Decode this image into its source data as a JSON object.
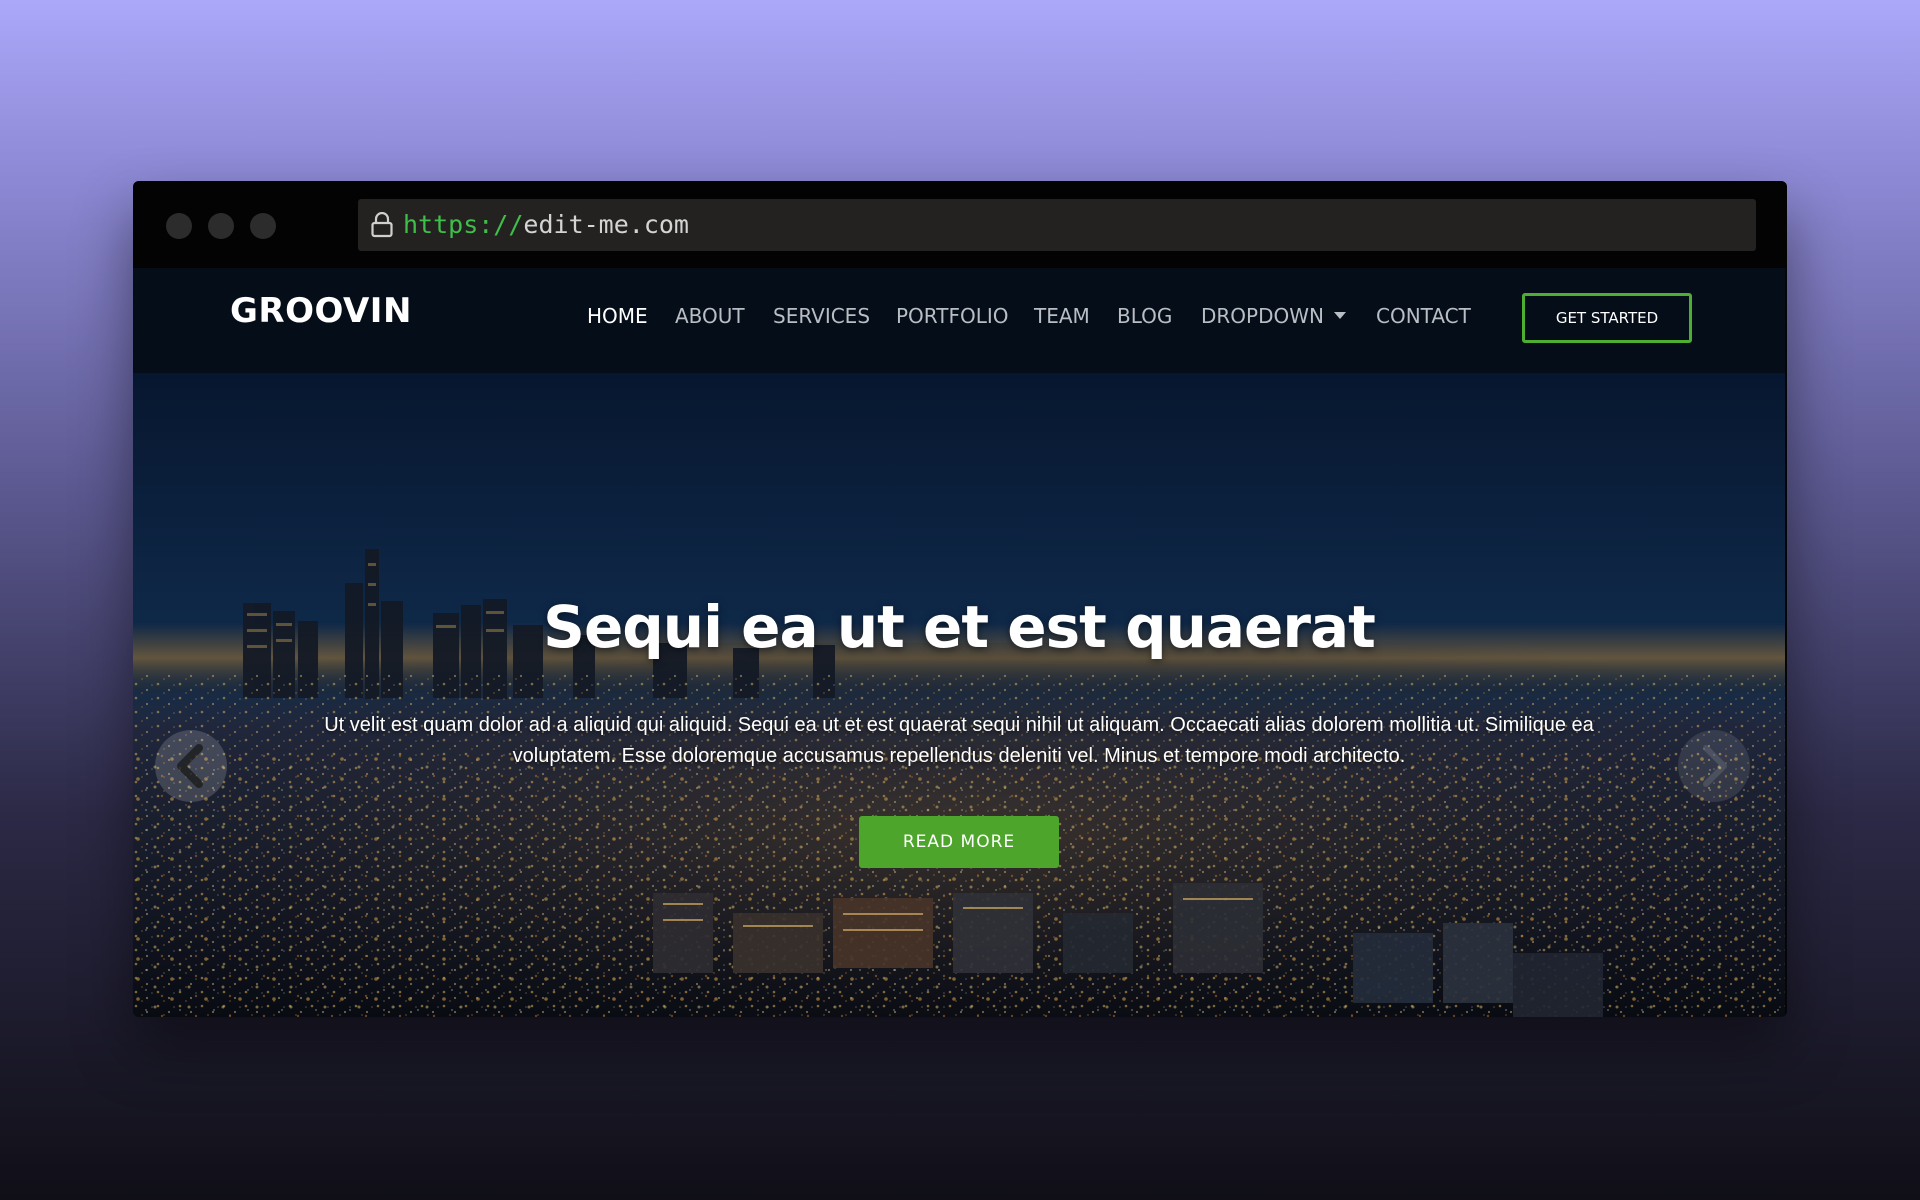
{
  "browser": {
    "url_scheme": "https://",
    "url_host": "edit-me.com"
  },
  "site": {
    "logo": "GROOVIN"
  },
  "nav": {
    "items": [
      {
        "label": "HOME",
        "active": true
      },
      {
        "label": "ABOUT",
        "active": false
      },
      {
        "label": "SERVICES",
        "active": false
      },
      {
        "label": "PORTFOLIO",
        "active": false
      },
      {
        "label": "TEAM",
        "active": false
      },
      {
        "label": "BLOG",
        "active": false
      },
      {
        "label": "DROPDOWN",
        "active": false
      },
      {
        "label": "CONTACT",
        "active": false
      }
    ],
    "cta_label": "GET STARTED"
  },
  "hero": {
    "title": "Sequi ea ut et est quaerat",
    "text": "Ut velit est quam dolor ad a aliquid qui aliquid. Sequi ea ut et est quaerat sequi nihil ut aliquam. Occaecati alias dolorem mollitia ut. Similique ea voluptatem. Esse doloremque accusamus repellendus deleniti vel. Minus et tempore modi architecto.",
    "button_label": "READ MORE"
  },
  "colors": {
    "accent": "#4ea52b",
    "header_bg": "#050d18",
    "url_scheme": "#3fbf4a"
  },
  "icons": {
    "lock": "lock-icon",
    "caret": "caret-down-icon",
    "prev": "chevron-left-icon",
    "next": "chevron-right-icon"
  }
}
